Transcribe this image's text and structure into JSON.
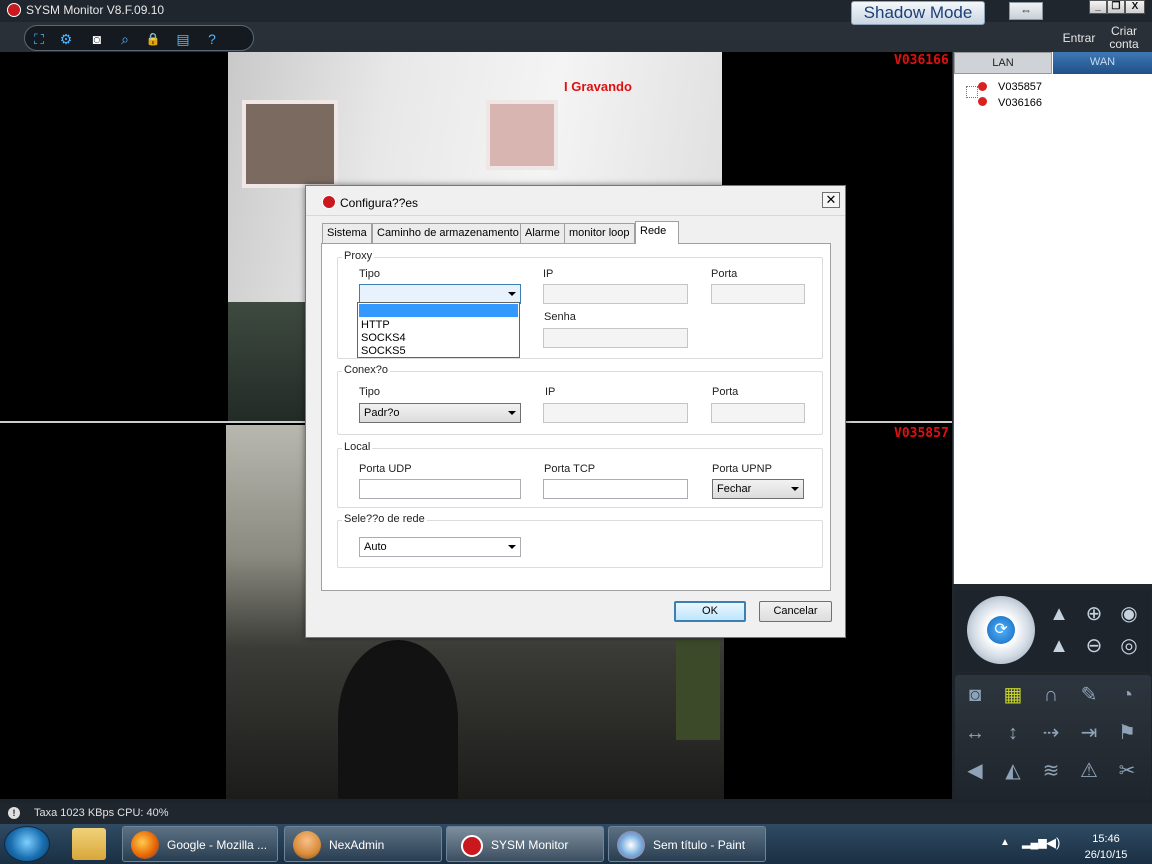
{
  "window": {
    "title": "SYSM Monitor  V8.F.09.10",
    "shadow_mode": "Shadow Mode",
    "swap_icon": "⇔",
    "minimize": "_",
    "restore": "❐",
    "close": "X",
    "entrar": "Entrar",
    "criar_conta_1": "Criar",
    "criar_conta_2": "conta"
  },
  "toolbar": {
    "icons": [
      "fullscreen-icon",
      "settings-gear-icon",
      "camera-snapshot-icon",
      "search-icon",
      "lock-icon",
      "save-icon",
      "help-icon"
    ],
    "glyphs": [
      "⛶",
      "⚙",
      "◙",
      "⌕",
      "🔒",
      "▤",
      "?"
    ]
  },
  "cameras": {
    "top_label": "V036166",
    "bottom_label": "V035857",
    "recording": "I Gravando"
  },
  "dialog": {
    "title": "Configura??es",
    "close": "✕",
    "tabs": [
      "Sistema",
      "Caminho de armazenamento",
      "Alarme",
      "monitor loop",
      "Rede"
    ],
    "active_tab": "Rede",
    "proxy": {
      "group": "Proxy",
      "tipo": "Tipo",
      "ip": "IP",
      "porta": "Porta",
      "senha": "Senha",
      "tipo_value": "",
      "options": [
        "",
        "HTTP",
        "SOCKS4",
        "SOCKS5"
      ]
    },
    "conexao": {
      "group": "Conex?o",
      "tipo": "Tipo",
      "ip": "IP",
      "porta": "Porta",
      "tipo_value": "Padr?o"
    },
    "local": {
      "group": "Local",
      "porta_udp": "Porta UDP",
      "porta_tcp": "Porta TCP",
      "porta_upnp": "Porta UPNP",
      "upnp_value": "Fechar"
    },
    "selecao": {
      "group": "Sele??o de rede",
      "value": "Auto"
    },
    "ok": "OK",
    "cancel": "Cancelar"
  },
  "devices": {
    "lan_tab": "LAN",
    "wan_tab": "WAN",
    "items": [
      "V035857",
      "V036166"
    ]
  },
  "status": {
    "text": "Taxa 1023 KBps  CPU:  40%"
  },
  "taskbar": {
    "apps": [
      {
        "label": "Google - Mozilla ...",
        "icon": "firefox-icon",
        "color": "#e66000"
      },
      {
        "label": "NexAdmin",
        "icon": "user-icon",
        "color": "#d98b3a"
      },
      {
        "label": "SYSM Monitor",
        "icon": "sysm-icon",
        "color": "#c9181e"
      },
      {
        "label": "Sem título - Paint",
        "icon": "paint-icon",
        "color": "#6fa8dc"
      }
    ],
    "time": "15:46",
    "date": "26/10/15"
  }
}
